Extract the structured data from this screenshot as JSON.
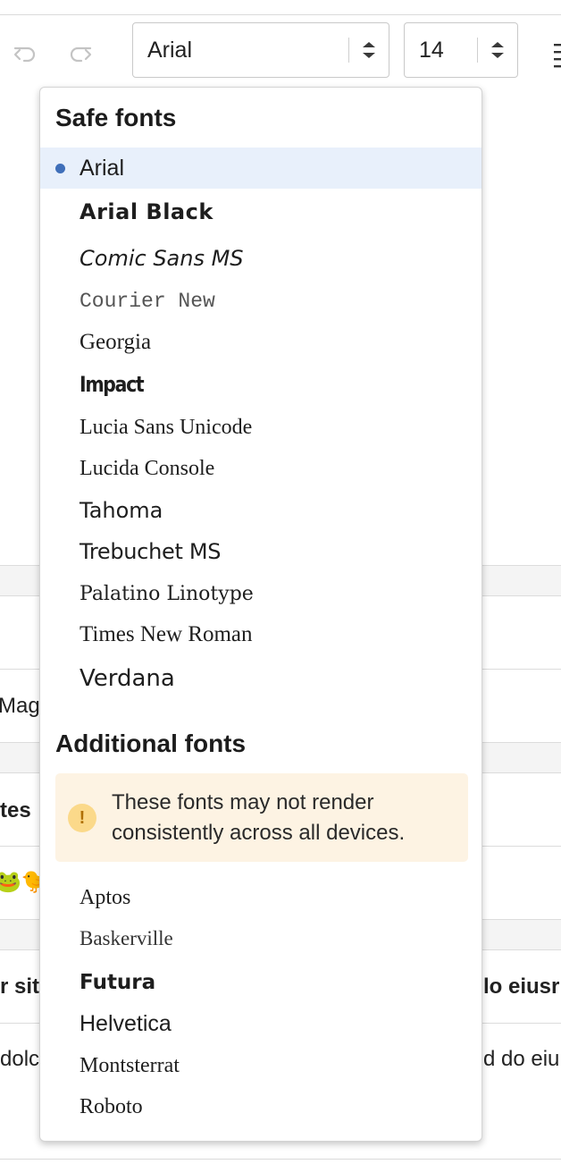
{
  "toolbar": {
    "font_select": {
      "value": "Arial"
    },
    "size_select": {
      "value": "14"
    }
  },
  "background": {
    "fragments": [
      "Mag",
      "tes",
      "🐸🐤",
      "r sit",
      "lo eiusr",
      "dolc",
      "d do eiu"
    ]
  },
  "dropdown": {
    "safe_title": "Safe fonts",
    "safe_fonts": [
      {
        "label": "Arial",
        "selected": true
      },
      {
        "label": "Arial Black"
      },
      {
        "label": "Comic Sans MS"
      },
      {
        "label": "Courier New"
      },
      {
        "label": "Georgia"
      },
      {
        "label": "Impact"
      },
      {
        "label": "Lucia Sans Unicode"
      },
      {
        "label": "Lucida Console"
      },
      {
        "label": "Tahoma"
      },
      {
        "label": "Trebuchet MS"
      },
      {
        "label": "Palatino Linotype"
      },
      {
        "label": "Times New Roman"
      },
      {
        "label": "Verdana"
      }
    ],
    "additional_title": "Additional fonts",
    "warning": {
      "icon": "!",
      "text": "These fonts may not render consistently across all devices."
    },
    "additional_fonts": [
      {
        "label": "Aptos"
      },
      {
        "label": "Baskerville"
      },
      {
        "label": "Futura"
      },
      {
        "label": "Helvetica"
      },
      {
        "label": "Montsterrat"
      },
      {
        "label": "Roboto"
      }
    ]
  },
  "colors": {
    "selected_bg": "#e8f0fb",
    "selected_dot": "#3f6fb9",
    "warning_bg": "#fdf3e3",
    "warning_icon": "#fbd98a"
  }
}
